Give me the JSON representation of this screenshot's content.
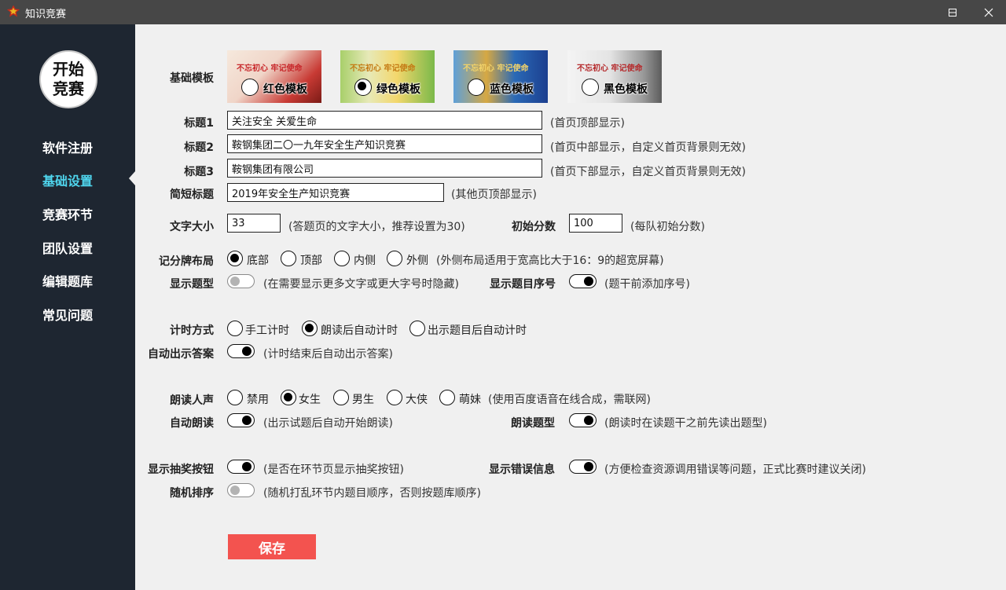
{
  "window": {
    "title": "知识竞赛",
    "minimize_icon": "minimize-icon",
    "maximize_icon": "maximize-icon",
    "close_icon": "close-icon"
  },
  "sidebar": {
    "logo_line1": "开始",
    "logo_line2": "竞赛",
    "items": [
      {
        "label": "软件注册"
      },
      {
        "label": "基础设置",
        "active": true
      },
      {
        "label": "竞赛环节"
      },
      {
        "label": "团队设置"
      },
      {
        "label": "编辑题库"
      },
      {
        "label": "常见问题"
      }
    ],
    "active_color": "#4fd6ee"
  },
  "form": {
    "template": {
      "label": "基础模板",
      "options": [
        {
          "label": "红色模板",
          "banner": "不忘初心 牢记使命",
          "selected": false
        },
        {
          "label": "绿色模板",
          "banner": "不忘初心 牢记使命",
          "selected": true
        },
        {
          "label": "蓝色模板",
          "banner": "不忘初心 牢记使命",
          "selected": false
        },
        {
          "label": "黑色模板",
          "banner": "不忘初心 牢记使命",
          "selected": false
        }
      ]
    },
    "title1": {
      "label": "标题1",
      "value": "关注安全 关爱生命",
      "hint": "(首页顶部显示)"
    },
    "title2": {
      "label": "标题2",
      "value": "鞍钢集团二〇一九年安全生产知识竞赛",
      "hint": "(首页中部显示，自定义首页背景则无效)"
    },
    "title3": {
      "label": "标题3",
      "value": "鞍钢集团有限公司",
      "hint": "(首页下部显示，自定义首页背景则无效)"
    },
    "short_title": {
      "label": "简短标题",
      "value": "2019年安全生产知识竞赛",
      "hint": "(其他页顶部显示)"
    },
    "font_size": {
      "label": "文字大小",
      "value": "33",
      "hint": "(答题页的文字大小，推荐设置为30)"
    },
    "initial_score": {
      "label": "初始分数",
      "value": "100",
      "hint": "(每队初始分数)"
    },
    "scoreboard_layout": {
      "label": "记分牌布局",
      "options": [
        {
          "label": "底部",
          "selected": true
        },
        {
          "label": "顶部",
          "selected": false
        },
        {
          "label": "内侧",
          "selected": false
        },
        {
          "label": "外侧",
          "selected": false
        }
      ],
      "hint": "(外侧布局适用于宽高比大于16：9的超宽屏幕)"
    },
    "show_question_type": {
      "label": "显示题型",
      "on": false,
      "hint": "(在需要显示更多文字或更大字号时隐藏)"
    },
    "show_question_number": {
      "label": "显示题目序号",
      "on": true,
      "hint": "(题干前添加序号)"
    },
    "timing_mode": {
      "label": "计时方式",
      "options": [
        {
          "label": "手工计时",
          "selected": false
        },
        {
          "label": "朗读后自动计时",
          "selected": true
        },
        {
          "label": "出示题目后自动计时",
          "selected": false
        }
      ]
    },
    "auto_show_answer": {
      "label": "自动出示答案",
      "on": true,
      "hint": "(计时结束后自动出示答案)"
    },
    "voice": {
      "label": "朗读人声",
      "options": [
        {
          "label": "禁用",
          "selected": false
        },
        {
          "label": "女生",
          "selected": true
        },
        {
          "label": "男生",
          "selected": false
        },
        {
          "label": "大侠",
          "selected": false
        },
        {
          "label": "萌妹",
          "selected": false
        }
      ],
      "hint": "(使用百度语音在线合成，需联网)"
    },
    "auto_read": {
      "label": "自动朗读",
      "on": true,
      "hint": "(出示试题后自动开始朗读)"
    },
    "read_question_type": {
      "label": "朗读题型",
      "on": true,
      "hint": "(朗读时在读题干之前先读出题型)"
    },
    "show_lottery_button": {
      "label": "显示抽奖按钮",
      "on": true,
      "hint": "(是否在环节页显示抽奖按钮)"
    },
    "show_error_info": {
      "label": "显示错误信息",
      "on": true,
      "hint": "(方便检查资源调用错误等问题，正式比赛时建议关闭)"
    },
    "random_order": {
      "label": "随机排序",
      "on": false,
      "hint": "(随机打乱环节内题目顺序，否则按题库顺序)"
    },
    "save_label": "保存",
    "save_color": "#f3534f"
  }
}
